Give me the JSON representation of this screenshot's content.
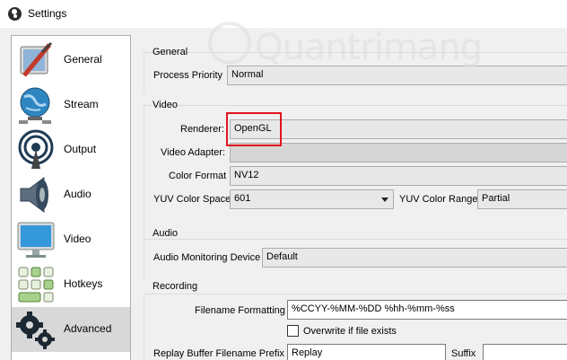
{
  "window": {
    "title": "Settings"
  },
  "sidebar": {
    "items": [
      {
        "label": "General",
        "icon": "general-settings-icon"
      },
      {
        "label": "Stream",
        "icon": "globe-network-icon"
      },
      {
        "label": "Output",
        "icon": "broadcast-antenna-icon"
      },
      {
        "label": "Audio",
        "icon": "speaker-icon"
      },
      {
        "label": "Video",
        "icon": "monitor-icon"
      },
      {
        "label": "Hotkeys",
        "icon": "keyboard-icon"
      },
      {
        "label": "Advanced",
        "icon": "gears-icon",
        "selected": true
      }
    ]
  },
  "groups": {
    "general": {
      "title": "General",
      "process_priority_label": "Process Priority",
      "process_priority_value": "Normal"
    },
    "video": {
      "title": "Video",
      "renderer_label": "Renderer:",
      "renderer_value": "OpenGL",
      "adapter_label": "Video Adapter:",
      "adapter_value": "",
      "color_format_label": "Color Format",
      "color_format_value": "NV12",
      "yuv_space_label": "YUV Color Space",
      "yuv_space_value": "601",
      "yuv_range_label": "YUV Color Range",
      "yuv_range_value": "Partial"
    },
    "audio": {
      "title": "Audio",
      "monitoring_label": "Audio Monitoring Device",
      "monitoring_value": "Default"
    },
    "recording": {
      "title": "Recording",
      "filename_label": "Filename Formatting",
      "filename_value": "%CCYY-%MM-%DD %hh-%mm-%ss",
      "overwrite_label": "Overwrite if file exists",
      "overwrite_checked": false,
      "replay_prefix_label": "Replay Buffer Filename Prefix",
      "replay_prefix_value": "Replay",
      "suffix_label": "Suffix",
      "suffix_value": ""
    }
  },
  "colors": {
    "highlight": "#e0141e",
    "selected_item": "#d8d8d8"
  },
  "watermark": {
    "text": "Quantrimang"
  }
}
